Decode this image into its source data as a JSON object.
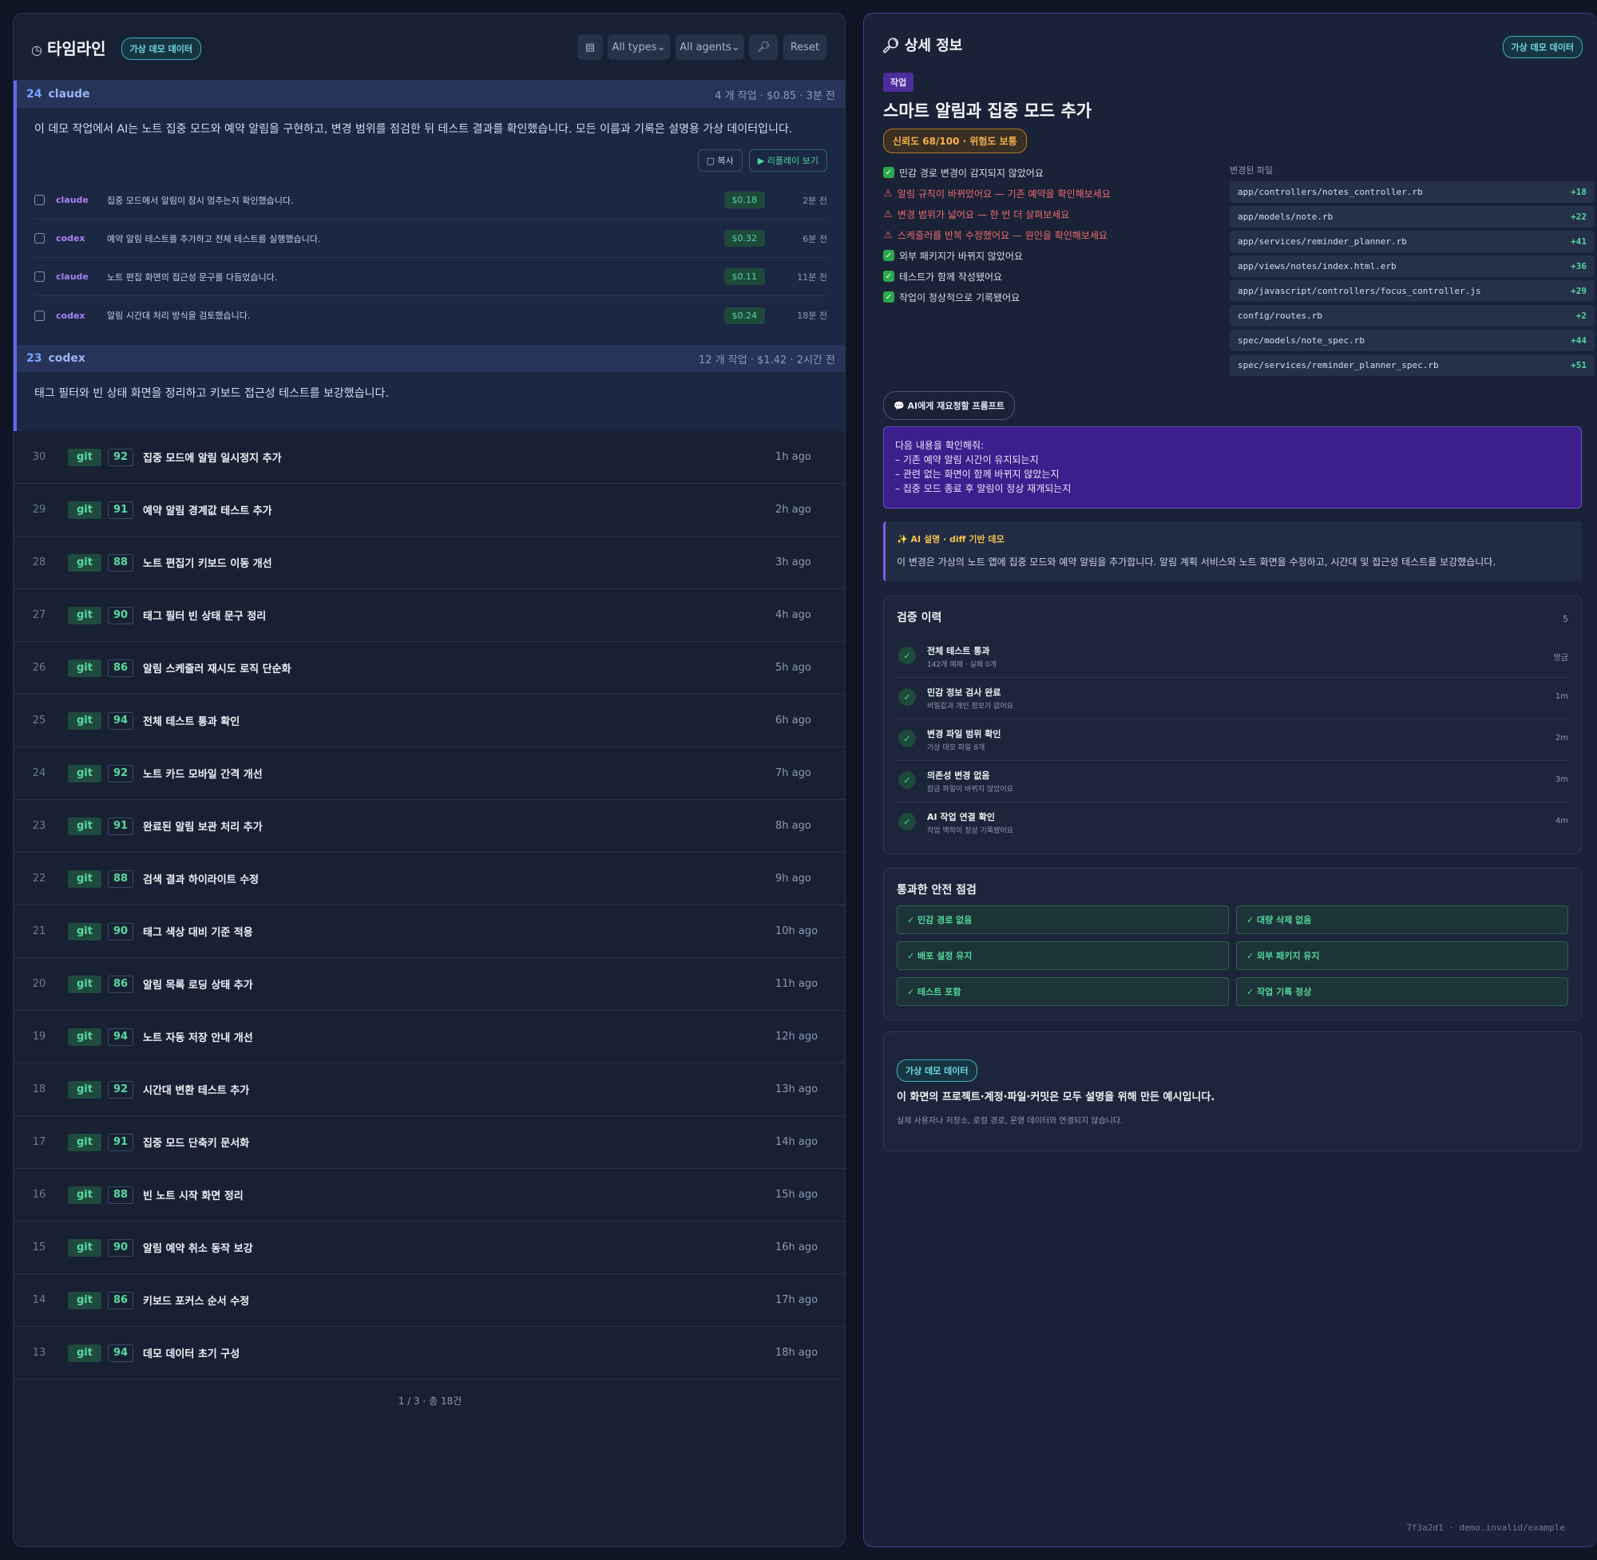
{
  "timeline": {
    "title": "타임라인",
    "title_icon": "clock-icon",
    "demo_badge": "가상 데모 데이터",
    "toolbar": {
      "view_icon": "list-icon",
      "types": "All types⌄",
      "agents": "All agents⌄",
      "search_icon": "magnifier-icon",
      "reset": "Reset"
    },
    "sessions": [
      {
        "num": "24",
        "agent": "claude",
        "meta": "4 개 작업 · $0.85 · 3분 전",
        "desc": "이 데모 작업에서 AI는 노트 집중 모드와 예약 알림을 구현하고, 변경 범위를 점검한 뒤 테스트 결과를 확인했습니다. 모든 이름과 기록은 설명용 가상 데이터입니다.",
        "copy": "▢ 복사",
        "replay": "▶ 리플레이 보기",
        "rows": [
          {
            "agent": "claude",
            "msg": "집중 모드에서 알림이 잠시 멈추는지 확인했습니다.",
            "cost": "$0.18",
            "ago": "2분 전"
          },
          {
            "agent": "codex",
            "msg": "예약 알림 테스트를 추가하고 전체 테스트를 실행했습니다.",
            "cost": "$0.32",
            "ago": "6분 전"
          },
          {
            "agent": "claude",
            "msg": "노트 편집 화면의 접근성 문구를 다듬었습니다.",
            "cost": "$0.11",
            "ago": "11분 전"
          },
          {
            "agent": "codex",
            "msg": "알림 시간대 처리 방식을 검토했습니다.",
            "cost": "$0.24",
            "ago": "18분 전"
          }
        ]
      },
      {
        "num": "23",
        "agent": "codex",
        "meta": "12 개 작업 · $1.42 · 2시간 전",
        "desc": "태그 필터와 빈 상태 화면을 정리하고 키보드 접근성 테스트를 보강했습니다."
      }
    ],
    "commits": [
      {
        "num": "30",
        "src": "git",
        "score": "92",
        "title": "집중 모드에 알림 일시정지 추가",
        "ago": "1h ago"
      },
      {
        "num": "29",
        "src": "git",
        "score": "91",
        "title": "예약 알림 경계값 테스트 추가",
        "ago": "2h ago"
      },
      {
        "num": "28",
        "src": "git",
        "score": "88",
        "title": "노트 편집기 키보드 이동 개선",
        "ago": "3h ago"
      },
      {
        "num": "27",
        "src": "git",
        "score": "90",
        "title": "태그 필터 빈 상태 문구 정리",
        "ago": "4h ago"
      },
      {
        "num": "26",
        "src": "git",
        "score": "86",
        "title": "알림 스케줄러 재시도 로직 단순화",
        "ago": "5h ago"
      },
      {
        "num": "25",
        "src": "git",
        "score": "94",
        "title": "전체 테스트 통과 확인",
        "ago": "6h ago"
      },
      {
        "num": "24",
        "src": "git",
        "score": "92",
        "title": "노트 카드 모바일 간격 개선",
        "ago": "7h ago"
      },
      {
        "num": "23",
        "src": "git",
        "score": "91",
        "title": "완료된 알림 보관 처리 추가",
        "ago": "8h ago"
      },
      {
        "num": "22",
        "src": "git",
        "score": "88",
        "title": "검색 결과 하이라이트 수정",
        "ago": "9h ago"
      },
      {
        "num": "21",
        "src": "git",
        "score": "90",
        "title": "태그 색상 대비 기준 적용",
        "ago": "10h ago"
      },
      {
        "num": "20",
        "src": "git",
        "score": "86",
        "title": "알림 목록 로딩 상태 추가",
        "ago": "11h ago"
      },
      {
        "num": "19",
        "src": "git",
        "score": "94",
        "title": "노트 자동 저장 안내 개선",
        "ago": "12h ago"
      },
      {
        "num": "18",
        "src": "git",
        "score": "92",
        "title": "시간대 변환 테스트 추가",
        "ago": "13h ago"
      },
      {
        "num": "17",
        "src": "git",
        "score": "91",
        "title": "집중 모드 단축키 문서화",
        "ago": "14h ago"
      },
      {
        "num": "16",
        "src": "git",
        "score": "88",
        "title": "빈 노트 시작 화면 정리",
        "ago": "15h ago"
      },
      {
        "num": "15",
        "src": "git",
        "score": "90",
        "title": "알림 예약 취소 동작 보강",
        "ago": "16h ago"
      },
      {
        "num": "14",
        "src": "git",
        "score": "86",
        "title": "키보드 포커스 순서 수정",
        "ago": "17h ago"
      },
      {
        "num": "13",
        "src": "git",
        "score": "94",
        "title": "데모 데이터 초기 구성",
        "ago": "18h ago"
      }
    ],
    "pager": "1 / 3 · 총 18건"
  },
  "detail": {
    "title": "상세 정보",
    "title_icon": "magnifier-icon",
    "demo_badge": "가상 데모 데이터",
    "tag": "작업",
    "heading": "스마트 알림과 집중 모드 추가",
    "trust": "신뢰도 68/100 · 위험도 보통",
    "checks": [
      {
        "ok": true,
        "text": "민감 경로 변경이 감지되지 않았어요"
      },
      {
        "ok": false,
        "text": "알림 규칙이 바뀌었어요 — 기존 예약을 확인해보세요"
      },
      {
        "ok": false,
        "text": "변경 범위가 넓어요 — 한 번 더 살펴보세요"
      },
      {
        "ok": false,
        "text": "스케줄러를 반복 수정했어요 — 원인을 확인해보세요"
      },
      {
        "ok": true,
        "text": "외부 패키지가 바뀌지 않았어요"
      },
      {
        "ok": true,
        "text": "테스트가 함께 작성됐어요"
      },
      {
        "ok": true,
        "text": "작업이 정상적으로 기록됐어요"
      }
    ],
    "files_label": "변경된 파일",
    "files": [
      {
        "path": "app/controllers/notes_controller.rb",
        "plus": "+18"
      },
      {
        "path": "app/models/note.rb",
        "plus": "+22"
      },
      {
        "path": "app/services/reminder_planner.rb",
        "plus": "+41"
      },
      {
        "path": "app/views/notes/index.html.erb",
        "plus": "+36"
      },
      {
        "path": "app/javascript/controllers/focus_controller.js",
        "plus": "+29"
      },
      {
        "path": "config/routes.rb",
        "plus": "+2"
      },
      {
        "path": "spec/models/note_spec.rb",
        "plus": "+44"
      },
      {
        "path": "spec/services/reminder_planner_spec.rb",
        "plus": "+51"
      }
    ],
    "prompt_label": "💬 AI에게 재요청할 프롬프트",
    "prompt_lines": [
      "다음 내용을 확인해줘:",
      "– 기존 예약 알림 시간이 유지되는지",
      "– 관련 없는 화면이 함께 바뀌지 않았는지",
      "– 집중 모드 종료 후 알림이 정상 재개되는지"
    ],
    "ai_head": "✨ AI 설명 · diff 기반 데모",
    "ai_body": "이 변경은 가상의 노트 앱에 집중 모드와 예약 알림을 추가합니다. 알림 계획 서비스와 노트 화면을 수정하고, 시간대 및 접근성 테스트를 보강했습니다.",
    "verify": {
      "title": "검증 이력",
      "count": "5",
      "rows": [
        {
          "t": "전체 테스트 통과",
          "s": "142개 예제 · 실패 0개",
          "a": "방금"
        },
        {
          "t": "민감 정보 검사 완료",
          "s": "비밀값과 개인 정보가 없어요",
          "a": "1m"
        },
        {
          "t": "변경 파일 범위 확인",
          "s": "가상 데모 파일 8개",
          "a": "2m"
        },
        {
          "t": "의존성 변경 없음",
          "s": "잠금 파일이 바뀌지 않았어요",
          "a": "3m"
        },
        {
          "t": "AI 작업 연결 확인",
          "s": "작업 맥락이 정상 기록됐어요",
          "a": "4m"
        }
      ]
    },
    "safety": {
      "title": "통과한 안전 점검",
      "items": [
        "✓ 민감 경로 없음",
        "✓ 대량 삭제 없음",
        "✓ 배포 설정 유지",
        "✓ 외부 패키지 유지",
        "✓ 테스트 포함",
        "✓ 작업 기록 정상"
      ]
    },
    "note": {
      "badge": "가상 데모 데이터",
      "title": "이 화면의 프로젝트·계정·파일·커밋은 모두 설명을 위해 만든 예시입니다.",
      "sub": "실제 사용자나 저장소, 로컬 경로, 운영 데이터와 연결되지 않습니다."
    },
    "footer": "7f3a2d1 · demo.invalid/example"
  },
  "colors": {
    "accent": "#6366f1",
    "green": "#54d69c",
    "purple_agent": "#a883f0",
    "warn": "#f06b6b"
  }
}
